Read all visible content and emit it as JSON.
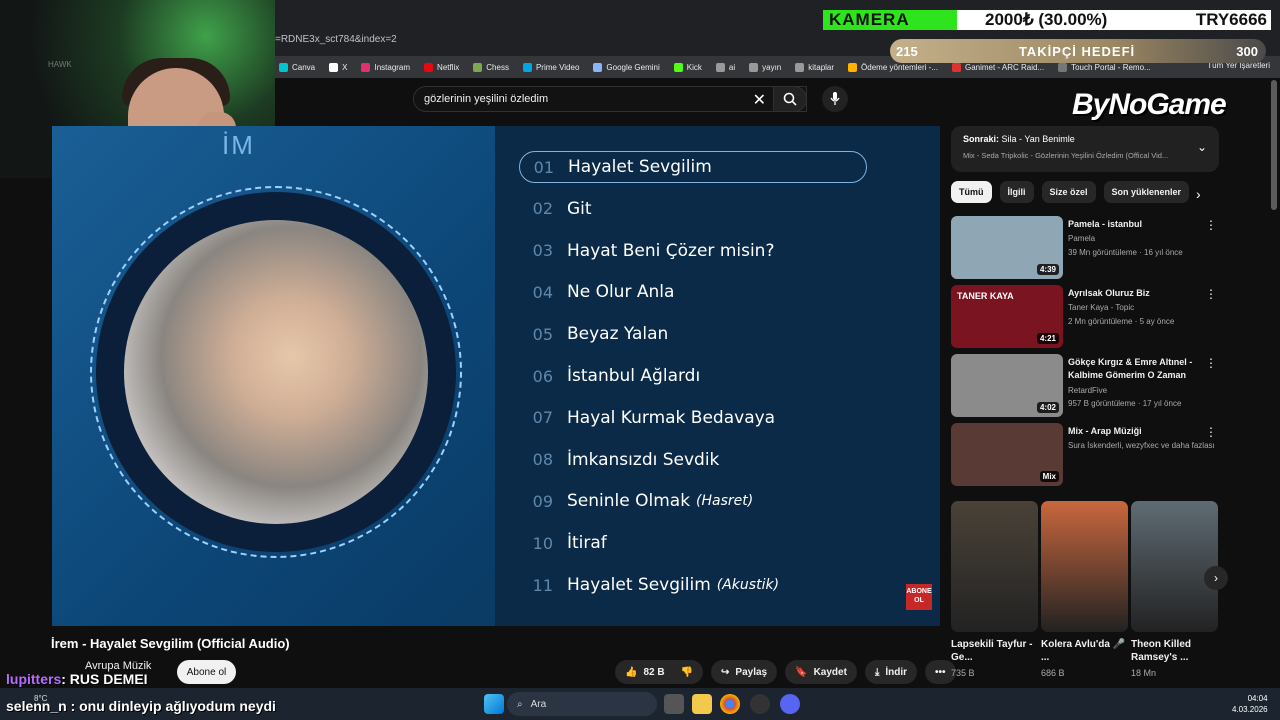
{
  "browser": {
    "url_fragment": "=RDNE3x_sct784&index=2",
    "bookmarks": [
      "Canva",
      "X",
      "Instagram",
      "Netflix",
      "Chess",
      "Prime Video",
      "Google Gemini",
      "Kick",
      "ai",
      "yayın",
      "kitaplar",
      "Ödeme yöntemleri -...",
      "Ganimet - ARC Raid...",
      "Touch Portal - Remo..."
    ],
    "bookmarks_right": "Tüm Yer İşaretleri"
  },
  "stream": {
    "kamera_label": "KAMERA",
    "kamera_amount": "2000₺ (30.00%)",
    "kamera_currency": "TRY6666",
    "goal_current": "215",
    "goal_label": "TAKİPÇİ HEDEFİ",
    "goal_target": "300",
    "brand": "ByNoGame",
    "chat_user": "lupitters",
    "chat_user_text": ": RUS DEMEI",
    "chat_line": "selenn_n : onu dinleyip ağlıyodum neydi"
  },
  "youtube": {
    "search_value": "gözlerinin yeşilini özledim",
    "video_title": "İrem - Hayalet Sevgilim (Official Audio)",
    "channel_name": "Avrupa Müzik",
    "subscribe_label": "Abone ol",
    "likes": "82 B",
    "share_label": "Paylaş",
    "save_label": "Kaydet",
    "download_label": "İndir",
    "album_title": "İM",
    "abone_badge": "ABONE OL",
    "tracks": [
      {
        "n": "01",
        "title": "Hayalet Sevgilim",
        "sub": ""
      },
      {
        "n": "02",
        "title": "Git",
        "sub": ""
      },
      {
        "n": "03",
        "title": "Hayat Beni Çözer misin?",
        "sub": ""
      },
      {
        "n": "04",
        "title": "Ne Olur Anla",
        "sub": ""
      },
      {
        "n": "05",
        "title": "Beyaz Yalan",
        "sub": ""
      },
      {
        "n": "06",
        "title": "İstanbul Ağlardı",
        "sub": ""
      },
      {
        "n": "07",
        "title": "Hayal Kurmak Bedavaya",
        "sub": ""
      },
      {
        "n": "08",
        "title": "İmkansızdı Sevdik",
        "sub": ""
      },
      {
        "n": "09",
        "title": "Seninle Olmak",
        "sub": "(Hasret)"
      },
      {
        "n": "10",
        "title": "İtiraf",
        "sub": ""
      },
      {
        "n": "11",
        "title": "Hayalet Sevgilim",
        "sub": "(Akustik)"
      }
    ],
    "next_label": "Sonraki:",
    "next_title": "Sila - Yan Benimle",
    "next_playlist": "Mix - Seda Tripkolic - Gözlerinin Yeşilini Özledim (Offical Vid...",
    "chips": [
      "Tümü",
      "İlgili",
      "Size özel",
      "Son yüklenenler"
    ],
    "recommendations": [
      {
        "title": "Pamela - istanbul",
        "channel": "Pamela",
        "meta": "39 Mn görüntüleme · 16 yıl önce",
        "duration": "4:39",
        "color": "#8fa7b5"
      },
      {
        "title": "Ayrılsak Oluruz Biz",
        "channel": "Taner Kaya - Topic",
        "meta": "2 Mn görüntüleme · 5 ay önce",
        "duration": "4:21",
        "color": "#7a1420",
        "thumb_text": "TANER KAYA"
      },
      {
        "title": "Gökçe Kırgız & Emre Altınel - Kalbime Gömerim O Zaman",
        "channel": "RetardFive",
        "meta": "957 B görüntüleme · 17 yıl önce",
        "duration": "4:02",
        "color": "#8b8b8b"
      },
      {
        "title": "Mix - Arap Müziği",
        "channel": "Sura İskenderli, wezyfxec ve daha fazlası",
        "meta": "",
        "duration": "Mix",
        "color": "#5a3a34"
      }
    ],
    "shorts": [
      {
        "title": "Lapsekili Tayfur - Ge...",
        "views": "735 B",
        "color": "#4a4238"
      },
      {
        "title": "Kolera Avlu'da 🎤 ...",
        "views": "686 B",
        "color": "#c9673e"
      },
      {
        "title": "Theon Killed Ramsey's ...",
        "views": "18 Mn",
        "color": "#5f6b73"
      }
    ]
  },
  "taskbar": {
    "search_placeholder": "Ara",
    "weather": "8°C",
    "time": "04:04",
    "date": "4.03.2026"
  }
}
